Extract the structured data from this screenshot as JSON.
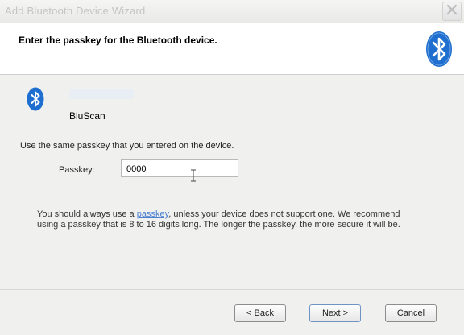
{
  "window": {
    "title": "Add Bluetooth Device Wizard",
    "close_glyph": "✕"
  },
  "header": {
    "title": "Enter the passkey for the Bluetooth device.",
    "icon": "bluetooth-icon"
  },
  "device": {
    "name": "BluScan",
    "icon": "bluetooth-icon"
  },
  "instruction": "Use the same passkey that you entered on the device.",
  "passkey": {
    "label": "Passkey:",
    "value": "0000"
  },
  "note": {
    "before": "You should always use a ",
    "link": "passkey",
    "after": ", unless your device does not support one. We recommend using a passkey that is 8 to 16 digits long. The longer the passkey, the more secure it will be."
  },
  "buttons": {
    "back": "< Back",
    "next": "Next >",
    "cancel": "Cancel"
  },
  "colors": {
    "bluetooth_blue": "#1f6fd0",
    "link": "#4a7fd0"
  }
}
